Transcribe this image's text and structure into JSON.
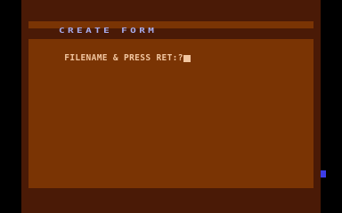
{
  "app": {
    "title": "CREATE FORM"
  },
  "prompt": {
    "label": "FILENAME & PRESS RET:?"
  },
  "colors": {
    "border": "#4a1a06",
    "playfield": "#7a3404",
    "title_text": "#a8aef0",
    "prompt_text": "#f2c6a0",
    "marker": "#3c3ce8"
  }
}
